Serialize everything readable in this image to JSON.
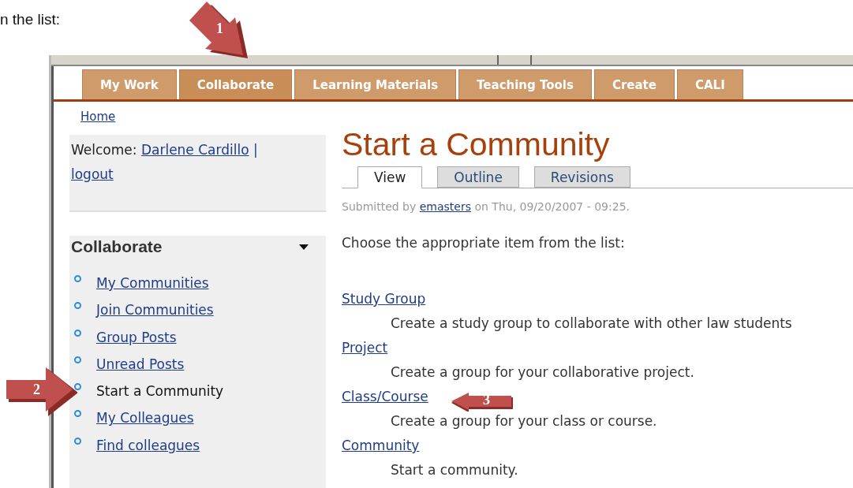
{
  "document_text": "n the list:",
  "nav_tabs": [
    {
      "label": "My Work",
      "selected": false
    },
    {
      "label": "Collaborate",
      "selected": true
    },
    {
      "label": "Learning Materials",
      "selected": false
    },
    {
      "label": "Teaching Tools",
      "selected": false
    },
    {
      "label": "Create",
      "selected": false
    },
    {
      "label": "CALI",
      "selected": false
    }
  ],
  "breadcrumb": "Home",
  "welcome": {
    "label": "Welcome:",
    "user": "Darlene Cardillo",
    "separator": "|",
    "logout": "logout"
  },
  "sidebar": {
    "title": "Collaborate",
    "expanded": true,
    "items": [
      {
        "label": "My Communities",
        "selected": false
      },
      {
        "label": "Join Communities",
        "selected": false
      },
      {
        "label": "Group Posts",
        "selected": false
      },
      {
        "label": "Unread Posts",
        "selected": false
      },
      {
        "label": "Start a Community",
        "selected": true
      },
      {
        "label": "My Colleagues",
        "selected": false
      },
      {
        "label": "Find colleagues",
        "selected": false
      }
    ]
  },
  "page": {
    "title": "Start a Community",
    "tabs": [
      {
        "label": "View",
        "selected": true
      },
      {
        "label": "Outline",
        "selected": false
      },
      {
        "label": "Revisions",
        "selected": false
      }
    ],
    "submitted": {
      "prefix": "Submitted by",
      "author": "emasters",
      "suffix": "on Thu, 09/20/2007 - 09:25."
    },
    "intro": "Choose the appropriate item from the list:",
    "options": [
      {
        "link": "Study Group",
        "description": "Create a study group to collaborate with other law students"
      },
      {
        "link": "Project",
        "description": "Create a group for your collaborative project."
      },
      {
        "link": "Class/Course",
        "description": "Create a group for your class or course."
      },
      {
        "link": "Community",
        "description": "Start a community."
      }
    ]
  },
  "callouts": [
    {
      "number": "1",
      "kind": "down"
    },
    {
      "number": "2",
      "kind": "right"
    },
    {
      "number": "3",
      "kind": "left"
    }
  ]
}
